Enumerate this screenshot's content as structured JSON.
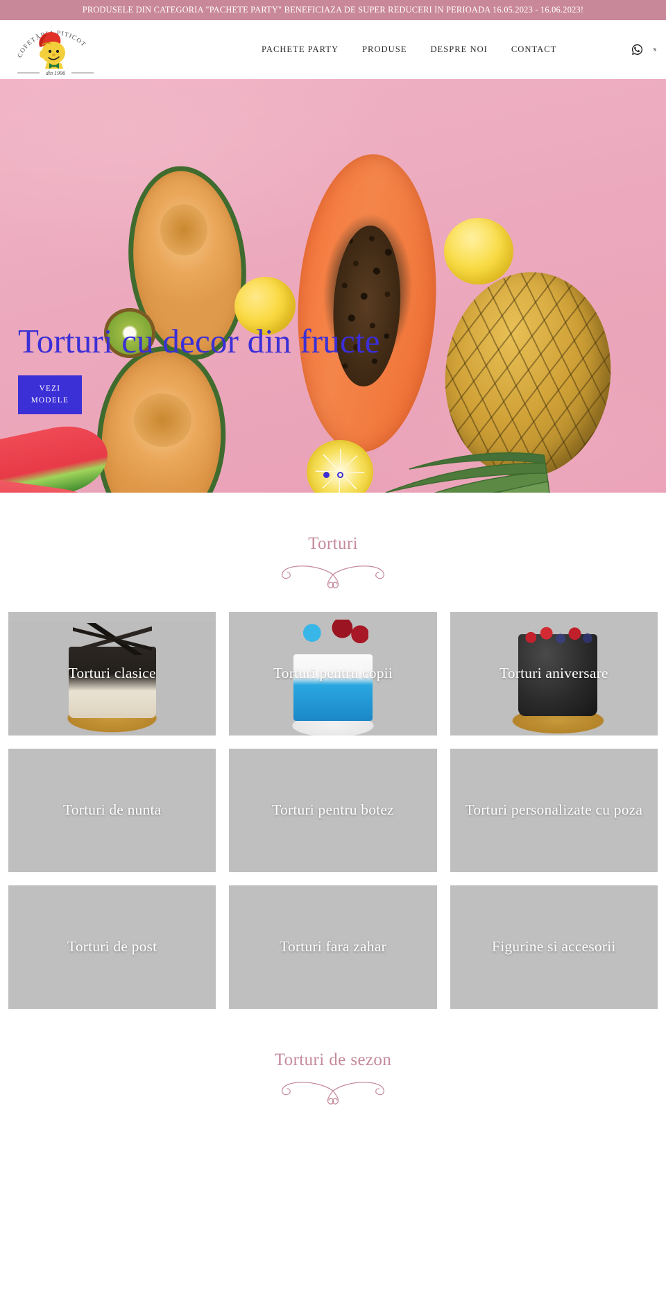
{
  "promo": {
    "text": "PRODUSELE DIN CATEGORIA \"PACHETE PARTY\" BENEFICIAZA DE SUPER REDUCERI IN PERIOADA 16.05.2023 - 16.06.2023!",
    "background_color": "#c98899",
    "text_color": "#ffffff"
  },
  "header": {
    "logo": {
      "arc_text": "COFETĂRIA PITICOT",
      "established": "din 1996",
      "icon": "piticot-dwarf-logo"
    },
    "nav": [
      {
        "label": "PACHETE PARTY"
      },
      {
        "label": "PRODUSE"
      },
      {
        "label": "DESPRE NOI"
      },
      {
        "label": "CONTACT"
      }
    ],
    "icons": [
      {
        "name": "whatsapp-icon",
        "label": ""
      },
      {
        "name": "search-icon",
        "label": "s"
      }
    ]
  },
  "hero": {
    "title": "Torturi cu decor din fructe",
    "button_label_line1": "VEZI",
    "button_label_line2": "MODELE",
    "accent_color": "#3b2fd6",
    "slides": [
      {
        "index": 1,
        "active": true
      },
      {
        "index": 2,
        "active": false
      }
    ]
  },
  "sections": [
    {
      "title": "Torturi",
      "title_color": "#c58a9b",
      "categories": [
        {
          "label": "Torturi clasice",
          "image": "loaded",
          "style": "ph-classic"
        },
        {
          "label": "Torturi pentru copii",
          "image": "loaded",
          "style": "ph-kids"
        },
        {
          "label": "Torturi aniversare",
          "image": "loaded",
          "style": "ph-aniv"
        },
        {
          "label": "Torturi de nunta",
          "image": "placeholder",
          "style": ""
        },
        {
          "label": "Torturi pentru botez",
          "image": "placeholder",
          "style": ""
        },
        {
          "label": "Torturi personalizate cu poza",
          "image": "placeholder",
          "style": ""
        },
        {
          "label": "Torturi de post",
          "image": "placeholder",
          "style": ""
        },
        {
          "label": "Torturi fara zahar",
          "image": "placeholder",
          "style": ""
        },
        {
          "label": "Figurine si accesorii",
          "image": "placeholder",
          "style": ""
        }
      ]
    },
    {
      "title": "Torturi de sezon",
      "title_color": "#c58a9b",
      "categories": []
    }
  ]
}
